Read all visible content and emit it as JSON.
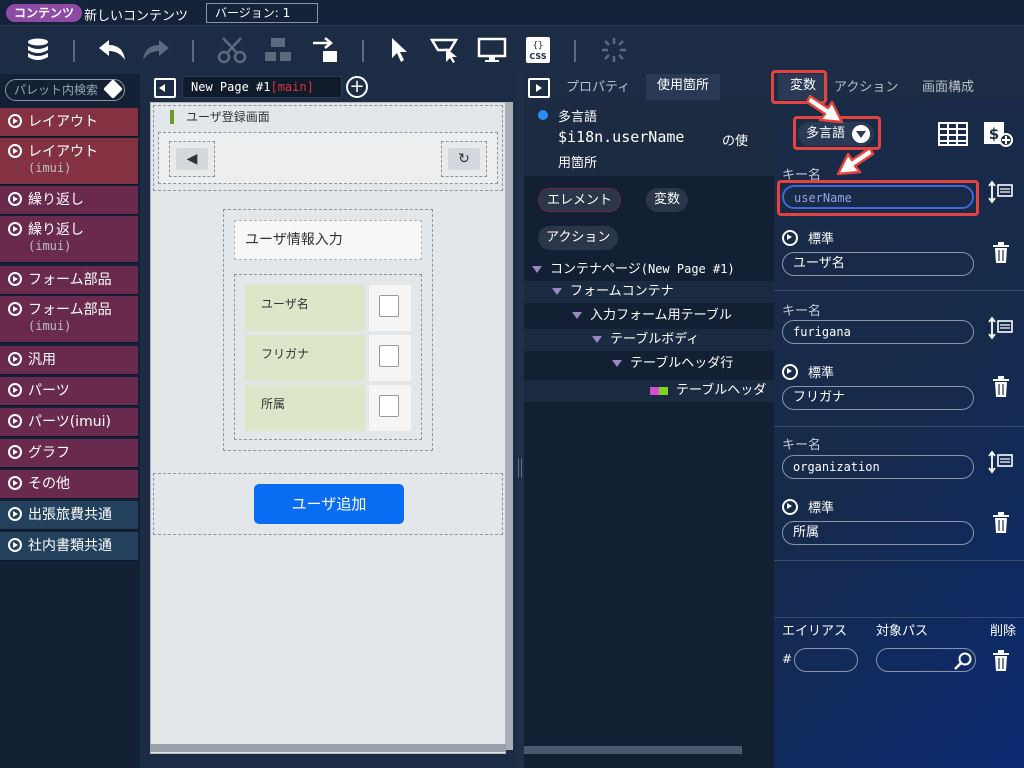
{
  "topbar": {
    "badge": "コンテンツ",
    "title": "新しいコンテンツ",
    "version": "バージョン: 1"
  },
  "left": {
    "search_placeholder": "パレット内検索",
    "items": [
      {
        "label": "レイアウト",
        "sub": ""
      },
      {
        "label": "レイアウト",
        "sub": "(imui)"
      },
      {
        "label": "繰り返し",
        "sub": ""
      },
      {
        "label": "繰り返し",
        "sub": "(imui)"
      },
      {
        "label": "フォーム部品",
        "sub": ""
      },
      {
        "label": "フォーム部品",
        "sub": "(imui)"
      },
      {
        "label": "汎用",
        "sub": ""
      },
      {
        "label": "パーツ",
        "sub": ""
      },
      {
        "label": "パーツ(imui)",
        "sub": ""
      },
      {
        "label": "グラフ",
        "sub": ""
      },
      {
        "label": "その他",
        "sub": ""
      },
      {
        "label": "出張旅費共通",
        "sub": ""
      },
      {
        "label": "社内書類共通",
        "sub": ""
      }
    ]
  },
  "canvas": {
    "tab_name": "New Page #1",
    "tab_suffix": "[main]",
    "screen_title": "ユーザ登録画面",
    "section_title": "ユーザ情報入力",
    "rows": [
      "ユーザ名",
      "フリガナ",
      "所属"
    ],
    "add_button": "ユーザ追加"
  },
  "mid": {
    "tab_properties": "プロパティ",
    "tab_usage": "使用箇所",
    "usage_header": "多言語",
    "usage_expr": "$i18n.userName",
    "usage_suffix_1": "の使",
    "usage_suffix_2": "用箇所",
    "filter_element": "エレメント",
    "filter_variable": "変数",
    "filter_action": "アクション",
    "tree": [
      {
        "label": "コンテナページ",
        "extra": "(New Page #1)"
      },
      {
        "label": "フォームコンテナ",
        "extra": ""
      },
      {
        "label": "入力フォーム用テーブル",
        "extra": ""
      },
      {
        "label": "テーブルボディ",
        "extra": ""
      },
      {
        "label": "テーブルヘッダ行",
        "extra": ""
      },
      {
        "label": "テーブルヘッダ",
        "extra": ""
      }
    ]
  },
  "right": {
    "tab_variable": "変数",
    "tab_action": "アクション",
    "tab_screen": "画面構成",
    "dropdown": "多言語",
    "key_label": "キー名",
    "std_label": "標準",
    "entries": [
      {
        "key": "userName",
        "value": "ユーザ名"
      },
      {
        "key": "furigana",
        "value": "フリガナ"
      },
      {
        "key": "organization",
        "value": "所属"
      }
    ],
    "alias_header": "エイリアス",
    "path_header": "対象パス",
    "delete_header": "削除",
    "hash": "#"
  },
  "colors": {
    "highlight": "#e5433f",
    "accent_button": "#0a6cf2",
    "palette_red": "#843241",
    "palette_magenta": "#6a2a4e",
    "palette_blue": "#23415d"
  }
}
